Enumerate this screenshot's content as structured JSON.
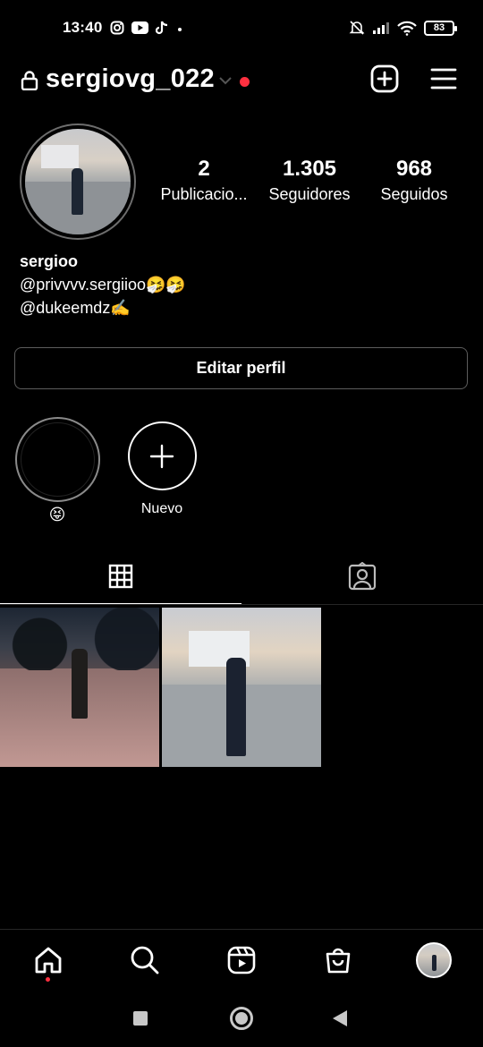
{
  "status_bar": {
    "time": "13:40",
    "battery": "83",
    "left_icons": [
      "instagram-icon",
      "youtube-icon",
      "tiktok-icon",
      "dot-icon"
    ],
    "right_icons": [
      "mute-icon",
      "signal-icon",
      "wifi-icon",
      "battery-icon"
    ]
  },
  "header": {
    "username": "sergiovg_022",
    "icons": [
      "lock-icon",
      "chevron-down-icon",
      "notification-dot",
      "add-post-icon",
      "menu-icon"
    ],
    "accent": "#ff3040"
  },
  "profile": {
    "stats": {
      "posts": {
        "value": "2",
        "label": "Publicacio..."
      },
      "followers": {
        "value": "1.305",
        "label": "Seguidores"
      },
      "following": {
        "value": "968",
        "label": "Seguidos"
      }
    },
    "name": "sergioo",
    "bio_line1": "@privvvv.sergiioo🤧🤧",
    "bio_line2": "@dukeemdz✍️"
  },
  "edit_profile_label": "Editar perfil",
  "highlights": [
    {
      "label": "😝"
    },
    {
      "label": "Nuevo"
    }
  ],
  "tabs": [
    {
      "icon": "grid-icon",
      "active": true
    },
    {
      "icon": "tagged-icon",
      "active": false
    }
  ],
  "posts": [
    {
      "description": "post-1"
    },
    {
      "description": "post-2"
    }
  ],
  "bottom_nav": [
    "home-icon",
    "search-icon",
    "reels-icon",
    "shop-icon",
    "profile-avatar"
  ]
}
